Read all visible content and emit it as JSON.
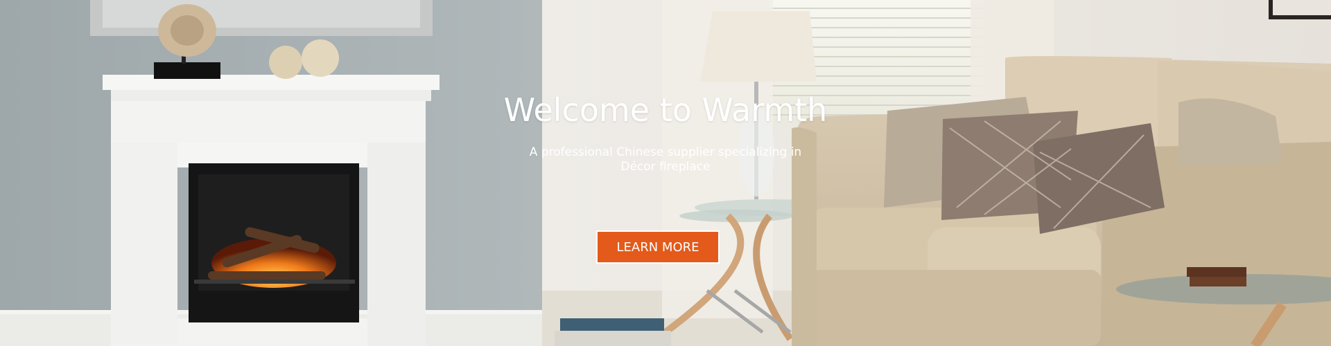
{
  "hero": {
    "title": "Welcome to Warmth",
    "subtitle": "A professional Chinese supplier specializing in Décor fireplace",
    "cta_label": "LEARN MORE",
    "background_image": "living-room-with-electric-fireplace-and-sofa",
    "colors": {
      "cta_background": "#e35a1a",
      "cta_text": "#ffffff",
      "wall_grey": "#a7b0b3",
      "wall_cream": "#ece8e1"
    }
  }
}
